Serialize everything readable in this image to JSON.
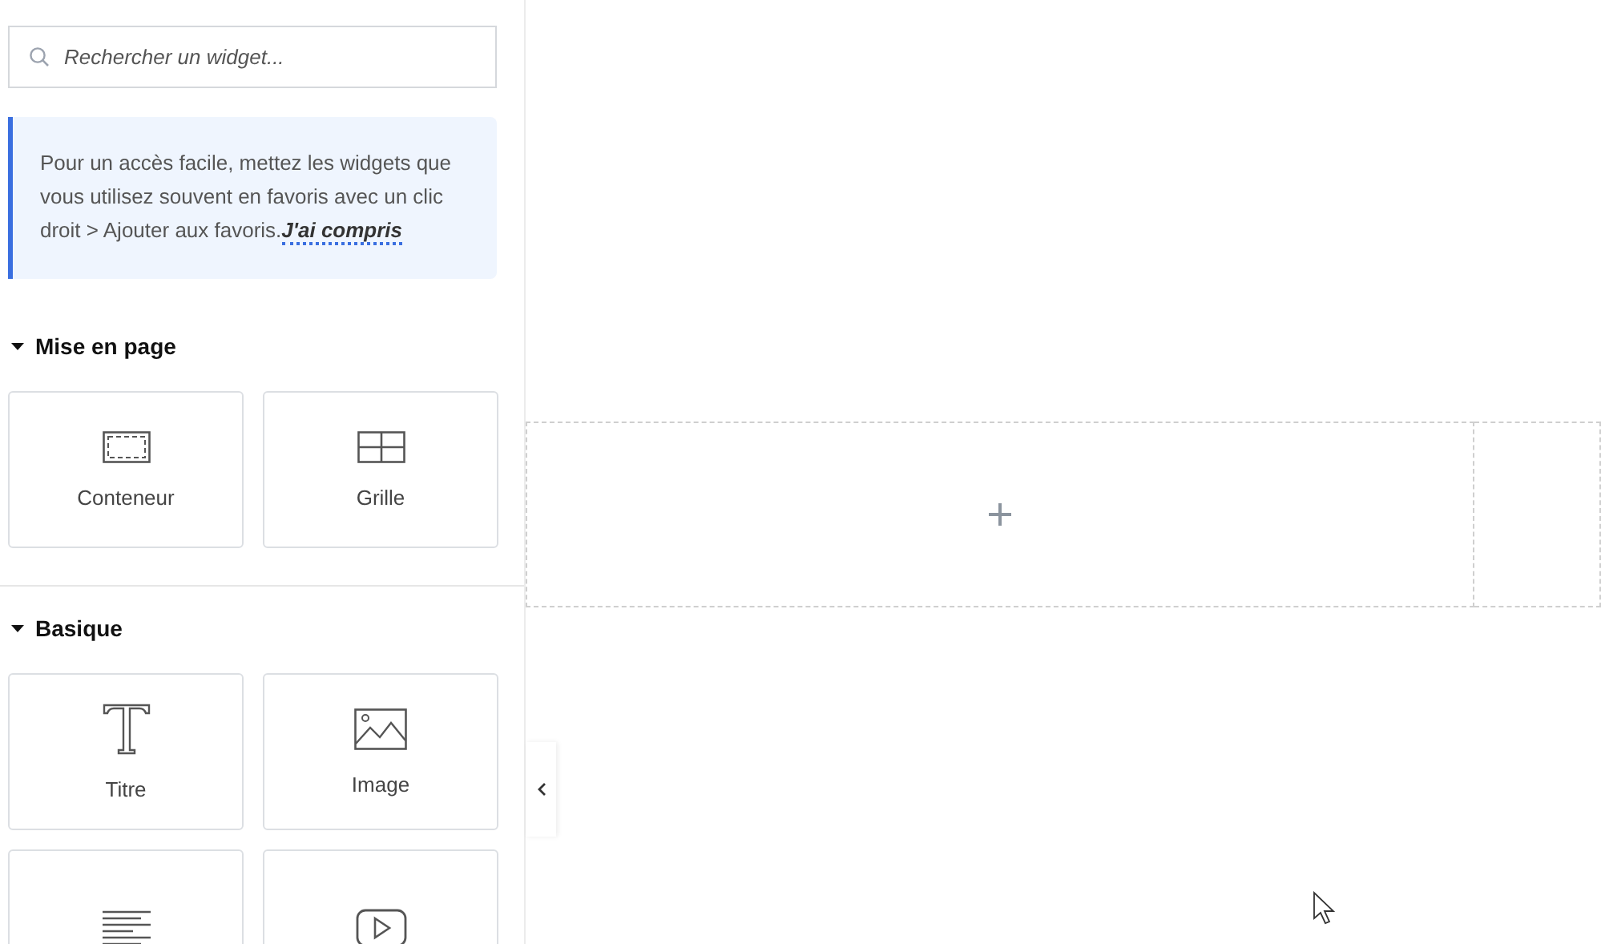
{
  "search": {
    "placeholder": "Rechercher un widget..."
  },
  "notice": {
    "text": "Pour un accès facile, mettez les widgets que vous utilisez souvent en favoris avec un clic droit > Ajouter aux favoris.",
    "link": "J'ai compris"
  },
  "sections": [
    {
      "title": "Mise en page",
      "expanded": true,
      "widgets": [
        {
          "kind": "container",
          "label": "Conteneur"
        },
        {
          "kind": "grid",
          "label": "Grille"
        }
      ]
    },
    {
      "title": "Basique",
      "expanded": true,
      "widgets": [
        {
          "kind": "heading",
          "label": "Titre"
        },
        {
          "kind": "image",
          "label": "Image"
        },
        {
          "kind": "text"
        },
        {
          "kind": "video"
        }
      ]
    }
  ]
}
